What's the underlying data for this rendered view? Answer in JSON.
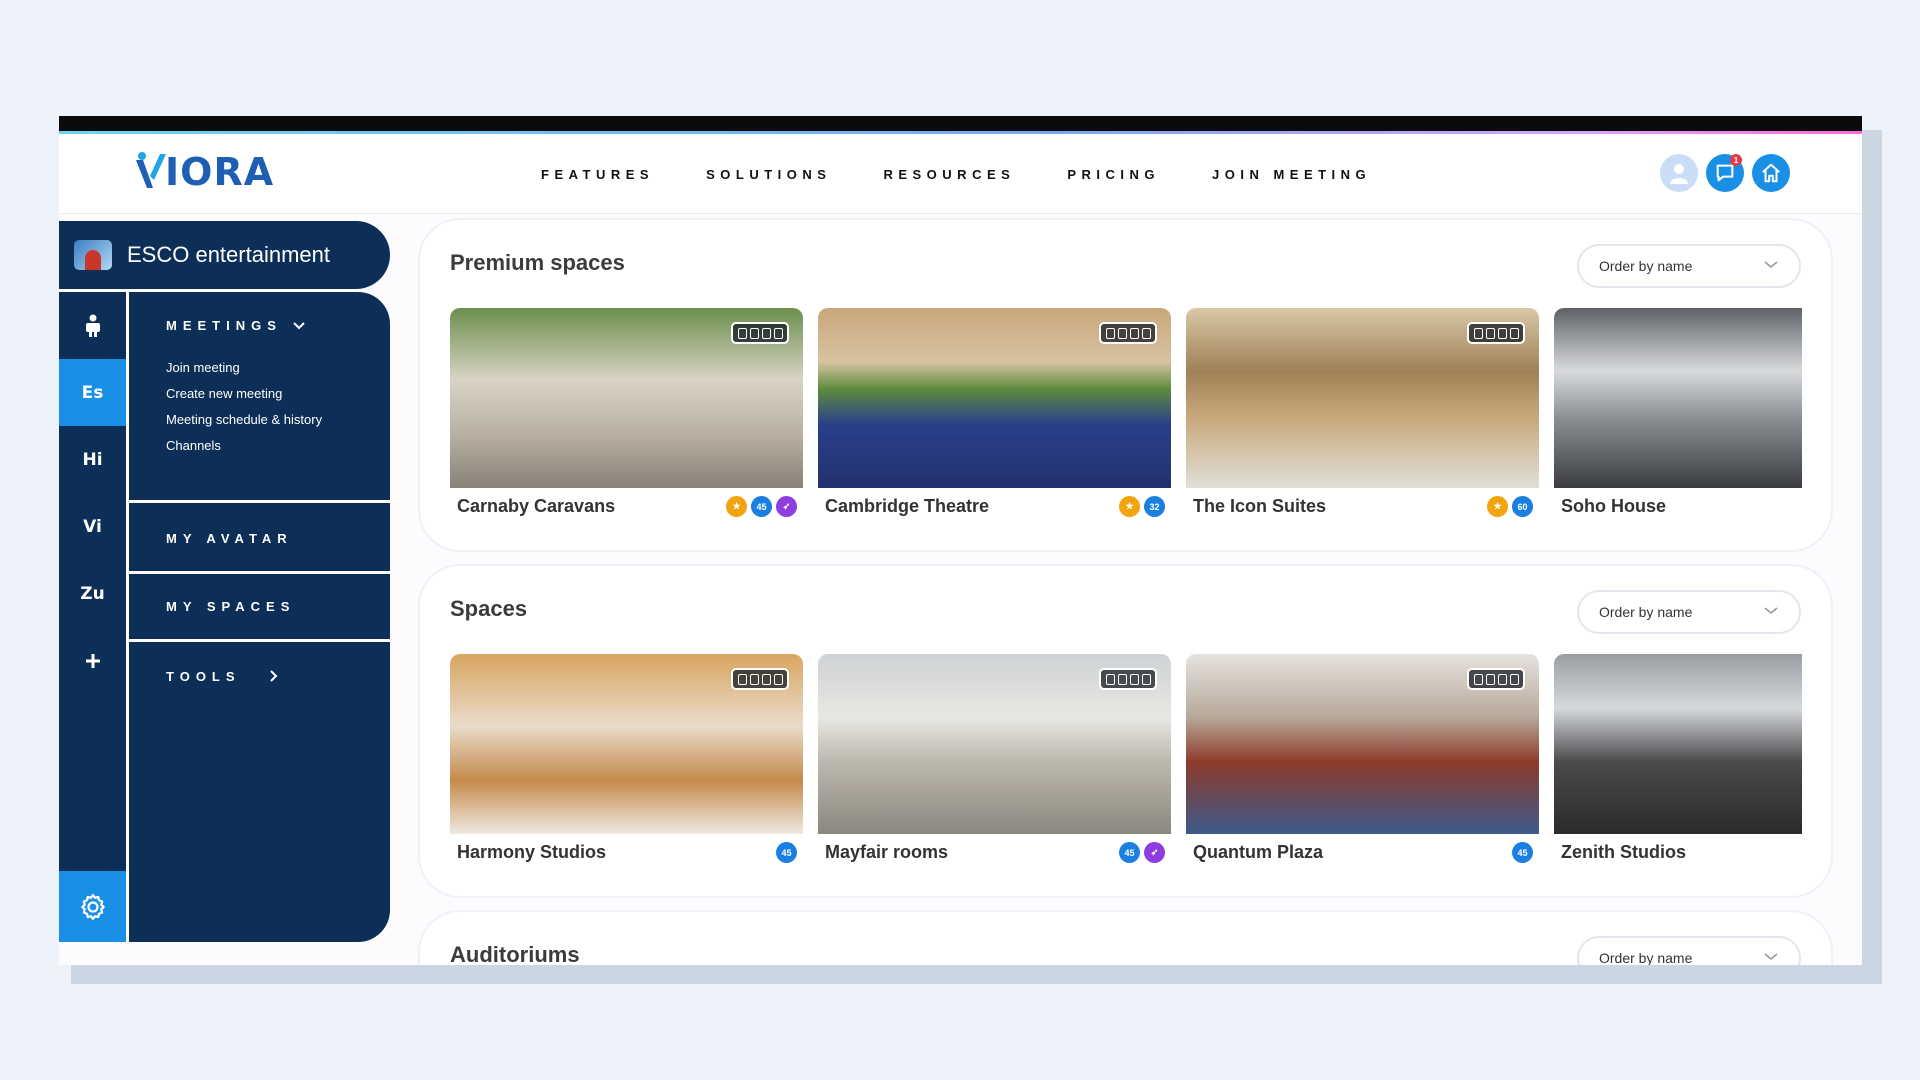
{
  "app": {
    "logo_text": "IORA"
  },
  "nav": [
    "FEATURES",
    "SOLUTIONS",
    "RESOURCES",
    "PRICING",
    "JOIN MEETING"
  ],
  "header_icons": {
    "notification_count": "1"
  },
  "org": {
    "name": "ESCO entertainment"
  },
  "rail": {
    "items": [
      "Es",
      "Hi",
      "Vi",
      "Zu"
    ],
    "active": "Es"
  },
  "panel": {
    "meetings": {
      "title": "MEETINGS",
      "items": [
        "Join meeting",
        "Create new meeting",
        "Meeting schedule & history",
        "Channels"
      ]
    },
    "my_avatar": "MY AVATAR",
    "my_spaces": "MY SPACES",
    "tools": "TOOLS"
  },
  "sections": [
    {
      "title": "Premium spaces",
      "order_label": "Order by name",
      "tiles": [
        {
          "name": "Carnaby Caravans",
          "badges": [
            "star",
            "45",
            "rocket"
          ]
        },
        {
          "name": "Cambridge Theatre",
          "badges": [
            "star",
            "32"
          ]
        },
        {
          "name": "The Icon Suites",
          "badges": [
            "star",
            "60"
          ]
        },
        {
          "name": "Soho House",
          "badges": []
        }
      ]
    },
    {
      "title": "Spaces",
      "order_label": "Order by name",
      "tiles": [
        {
          "name": "Harmony Studios",
          "badges": [
            "45"
          ]
        },
        {
          "name": "Mayfair rooms",
          "badges": [
            "45",
            "rocket"
          ]
        },
        {
          "name": "Quantum Plaza",
          "badges": [
            "45"
          ]
        },
        {
          "name": "Zenith Studios",
          "badges": []
        }
      ]
    },
    {
      "title": "Auditoriums",
      "order_label": "Order by name",
      "tiles": []
    }
  ],
  "colors": {
    "navy": "#0d2e57",
    "accent_blue": "#1a8fe6",
    "star": "#f2a40f",
    "capacity": "#1a7fe0",
    "rocket": "#8d3de0"
  }
}
